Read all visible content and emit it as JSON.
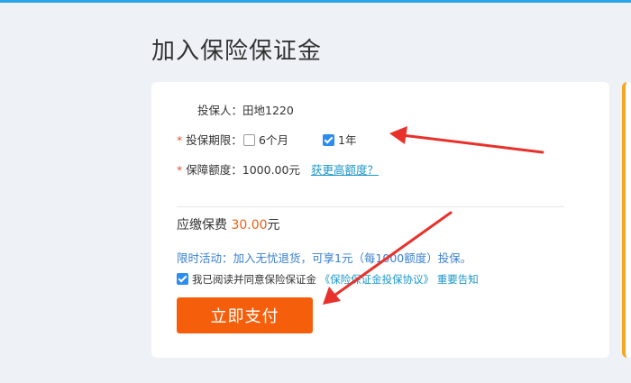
{
  "page": {
    "title": "加入保险保证金"
  },
  "form": {
    "insured_label": "投保人：",
    "insured_value": "田地1220",
    "period_label": "投保期限：",
    "period_options": [
      {
        "label": "6个月",
        "checked": false
      },
      {
        "label": "1年",
        "checked": true
      }
    ],
    "amount_label": "保障额度：",
    "amount_value": "1000.00元",
    "amount_link": "获更高额度？",
    "required_mark": "*"
  },
  "fee": {
    "label": "应缴保费",
    "amount": "30.00",
    "unit": "元"
  },
  "promo": {
    "text": "限时活动：加入无忧退货，可享1元（每1000额度）投保。"
  },
  "agreement": {
    "checked": true,
    "text": "我已阅读并同意保险保证金",
    "link": "《保险保证金投保协议》",
    "notice": "重要告知"
  },
  "pay_button": {
    "label": "立即支付"
  },
  "colors": {
    "accent": "#f55f0b",
    "link": "#1a96c9",
    "arrow": "#e8312b"
  }
}
